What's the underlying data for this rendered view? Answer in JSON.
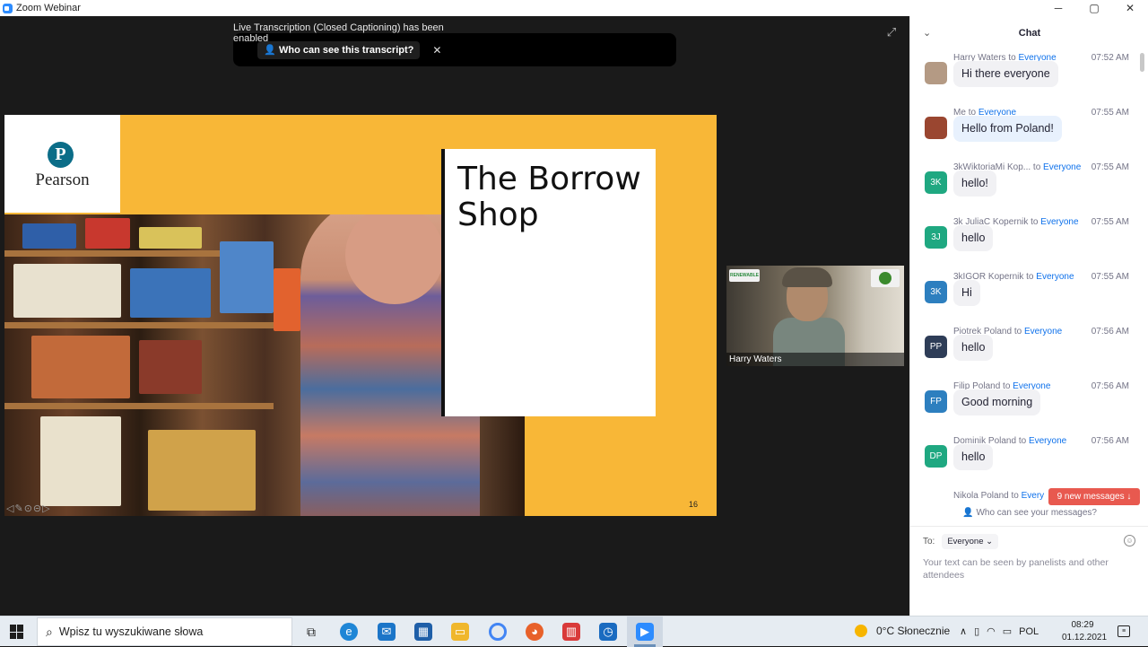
{
  "window": {
    "title": "Zoom Webinar",
    "min": "─",
    "max": "▢",
    "close": "✕"
  },
  "banner": {
    "message": "Live Transcription (Closed Captioning) has been enabled",
    "who_label": "Who can see this transcript?",
    "close": "✕"
  },
  "slide": {
    "logo_letter": "P",
    "logo_text": "Pearson",
    "title_line1": "The Borrow",
    "title_line2": "Shop",
    "page_number": "16",
    "nav_icons": [
      "◁",
      "✎",
      "⊙",
      "⊝",
      "▷"
    ]
  },
  "video": {
    "participant_name": "Harry Waters",
    "sign_text": "RENEWABLE"
  },
  "chat": {
    "title": "Chat",
    "collapse_icon": "⌄",
    "to_word": "to",
    "messages": [
      {
        "sender": "Harry Waters",
        "recipient": "Everyone",
        "time": "07:52 AM",
        "text": "Hi there everyone",
        "initials": "",
        "avatar_color": "#b49a84",
        "mine": false
      },
      {
        "sender": "Me",
        "recipient": "Everyone",
        "time": "07:55 AM",
        "text": "Hello from Poland!",
        "initials": "",
        "avatar_color": "#9a4630",
        "mine": true
      },
      {
        "sender": "3kWiktoriaMi Kop...",
        "recipient": "Everyone",
        "time": "07:55 AM",
        "text": "hello!",
        "initials": "3K",
        "avatar_color": "#1fa881",
        "mine": false
      },
      {
        "sender": "3k JuliaC Kopernik",
        "recipient": "Everyone",
        "time": "07:55 AM",
        "text": "hello",
        "initials": "3J",
        "avatar_color": "#1fa881",
        "mine": false
      },
      {
        "sender": "3kIGOR Kopernik",
        "recipient": "Everyone",
        "time": "07:55 AM",
        "text": "Hi",
        "initials": "3K",
        "avatar_color": "#2d7fbf",
        "mine": false
      },
      {
        "sender": "Piotrek Poland",
        "recipient": "Everyone",
        "time": "07:56 AM",
        "text": "hello",
        "initials": "PP",
        "avatar_color": "#2e3d57",
        "mine": false
      },
      {
        "sender": "Filip Poland",
        "recipient": "Everyone",
        "time": "07:56 AM",
        "text": "Good morning",
        "initials": "FP",
        "avatar_color": "#2d7fbf",
        "mine": false
      },
      {
        "sender": "Dominik Poland",
        "recipient": "Everyone",
        "time": "07:56 AM",
        "text": "hello",
        "initials": "DP",
        "avatar_color": "#1fa881",
        "mine": false
      },
      {
        "sender": "Nikola Poland",
        "recipient": "Every",
        "time": "",
        "text": "",
        "initials": "",
        "avatar_color": "#2e3d57",
        "mine": false
      }
    ],
    "new_messages": "9 new messages ↓",
    "who_can_see": "Who can see your messages?",
    "to_label": "To:",
    "to_value": "Everyone ⌄",
    "emoji_icon": "☺",
    "compose_placeholder": "Your text can be seen by panelists and other attendees"
  },
  "taskbar": {
    "search_placeholder": "Wpisz tu wyszukiwane słowa",
    "weather": "0°C  Słonecznie",
    "language": "POL",
    "time": "08:29",
    "date": "01.12.2021"
  }
}
